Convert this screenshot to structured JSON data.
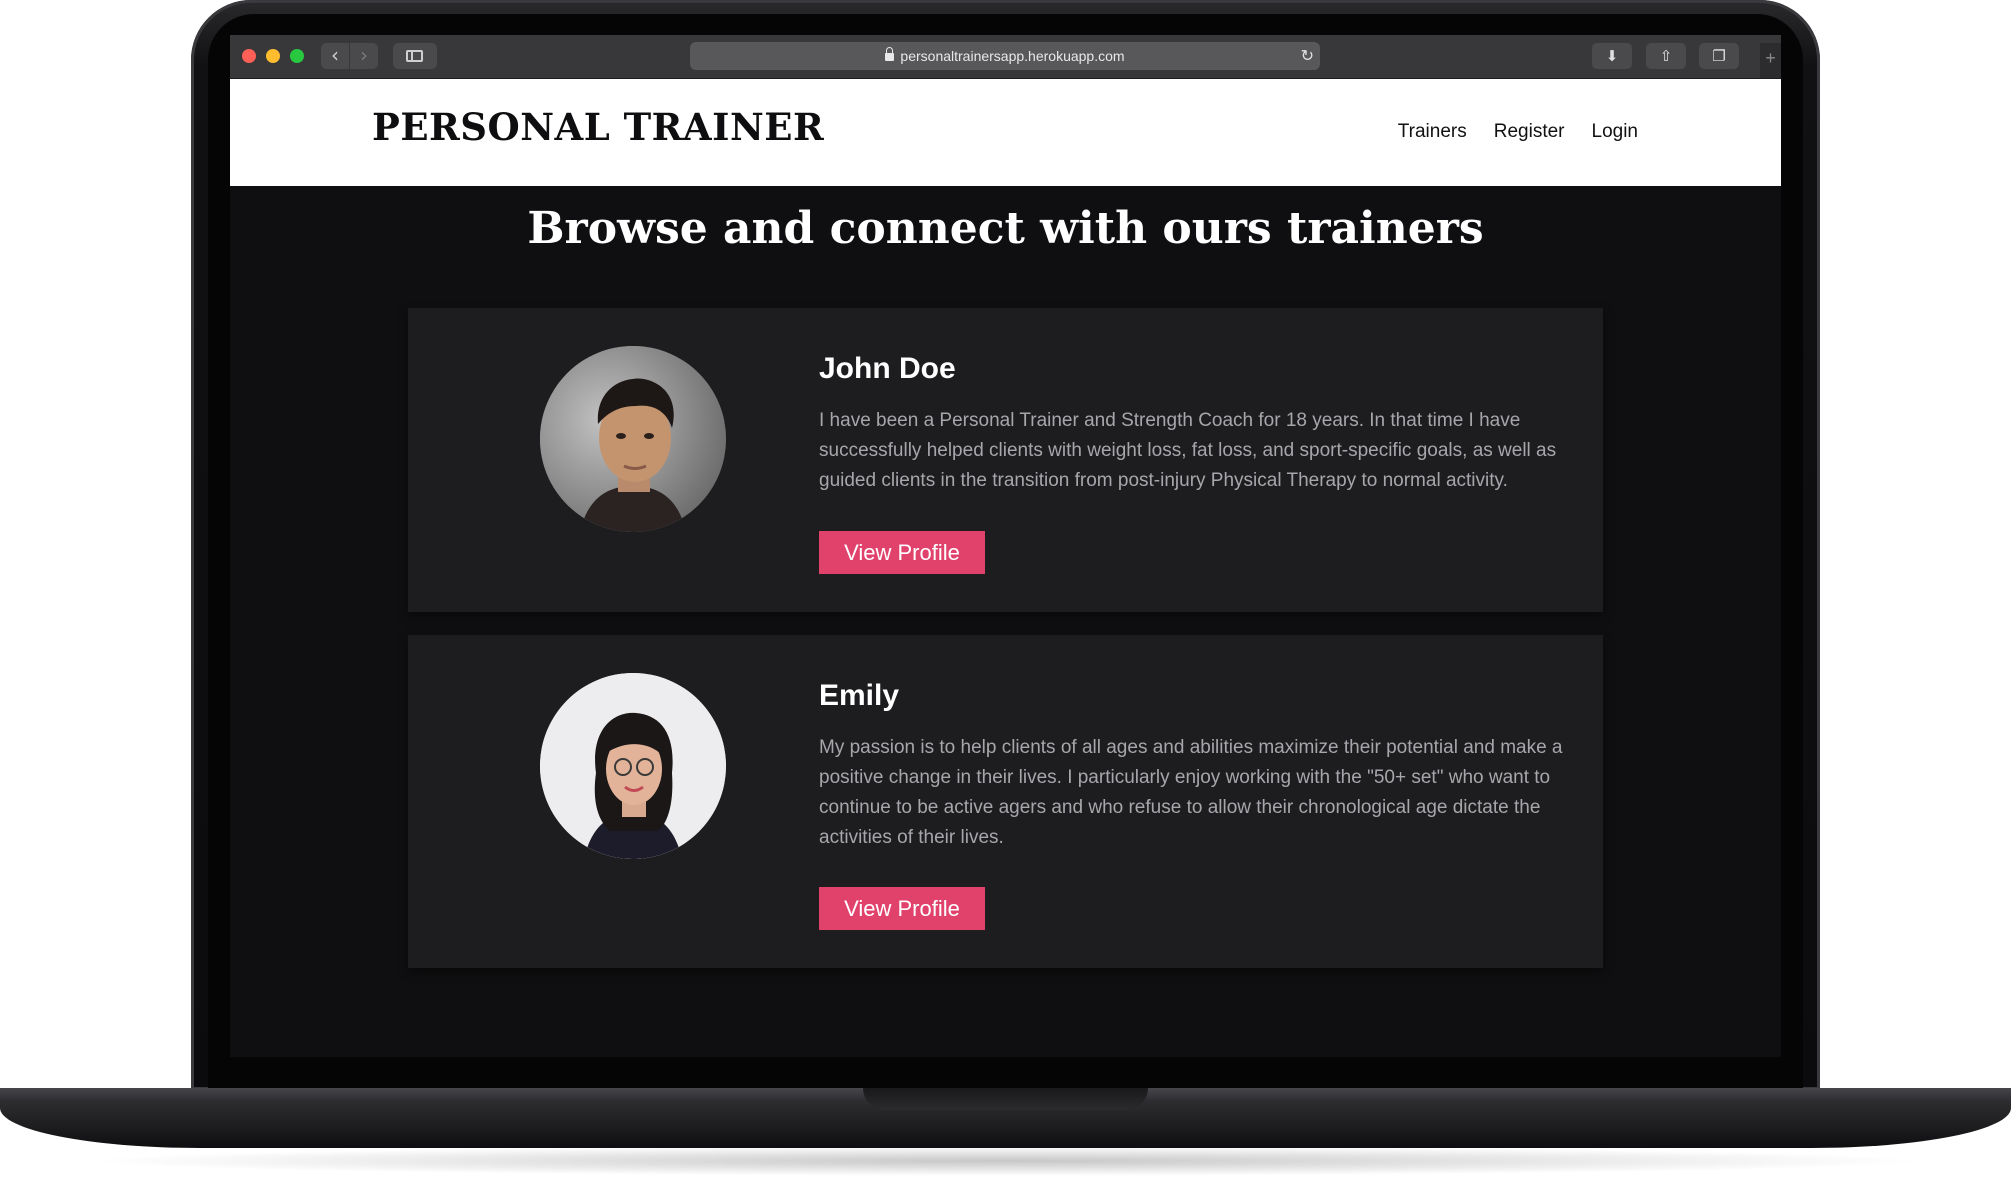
{
  "browser": {
    "url": "personaltrainersapp.herokuapp.com"
  },
  "site": {
    "brand": "PERSONAL TRAINER",
    "nav": [
      "Trainers",
      "Register",
      "Login"
    ]
  },
  "main": {
    "title": "Browse and connect with ours trainers",
    "trainers": [
      {
        "name": "John Doe",
        "bio": "I have been a Personal Trainer and Strength Coach for 18 years. In that time I have successfully helped clients with weight loss, fat loss, and sport-specific goals, as well as guided clients in the transition from post-injury Physical Therapy to normal activity.",
        "button": "View Profile"
      },
      {
        "name": "Emily",
        "bio": "My passion is to help clients of all ages and abilities maximize their potential and make a positive change in their lives. I particularly enjoy working with the \"50+ set\" who want to continue to be active agers and who refuse to allow their chronological age dictate the activities of their lives.",
        "button": "View Profile"
      }
    ]
  },
  "colors": {
    "accent": "#e0426c",
    "page_bg": "#0f0f11",
    "card_bg": "#1d1d20"
  },
  "icons": [
    "lock-icon",
    "reload-icon",
    "download-icon",
    "share-icon",
    "tabs-icon",
    "sidebar-icon",
    "back-icon",
    "forward-icon"
  ]
}
